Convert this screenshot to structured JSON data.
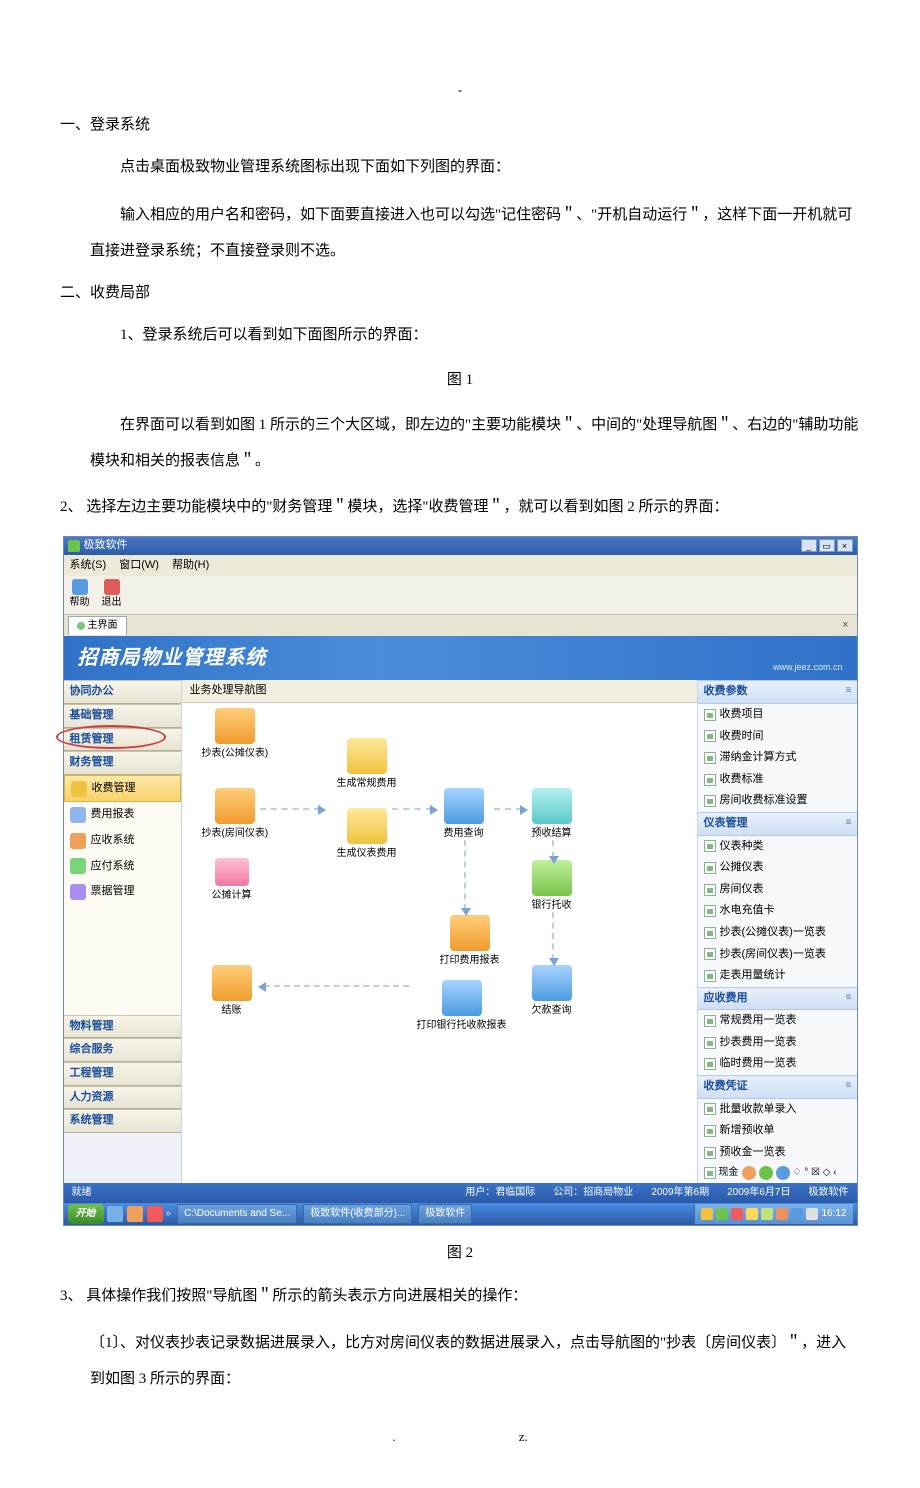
{
  "doc": {
    "dash": "-",
    "h1": "一、登录系统",
    "p1": "点击桌面极致物业管理系统图标出现下面如下列图的界面：",
    "p2": "输入相应的用户名和密码，如下面要直接进入也可以勾选\"记住密码＂、\"开机自动运行＂，这样下面一开机就可直接进登录系统；不直接登录则不选。",
    "h2": "二、收费局部",
    "p3": "1、登录系统后可以看到如下面图所示的界面：",
    "fig1": "图  1",
    "p4": "在界面可以看到如图 1 所示的三个大区域，即左边的\"主要功能模块＂、中间的\"处理导航图＂、右边的\"辅助功能模块和相关的报表信息＂。",
    "p5": "2、 选择左边主要功能模块中的\"财务管理＂模块，选择\"收费管理＂，就可以看到如图 2 所示的界面：",
    "fig2": "图 2",
    "p6": "3、 具体操作我们按照\"导航图＂所示的箭头表示方向进展相关的操作：",
    "p7": "〔1〕、对仪表抄表记录数据进展录入，比方对房间仪表的数据进展录入，点击导航图的\"抄表〔房间仪表〕＂，进入到如图 3 所示的界面：",
    "foot_left": ".",
    "foot_right": "z."
  },
  "app": {
    "title": "极致软件",
    "menu": {
      "sys": "系统(S)",
      "win": "窗口(W)",
      "help": "帮助(H)"
    },
    "toolbar": {
      "help": "帮助",
      "exit": "退出"
    },
    "tab": "主界面",
    "banner": "招商局物业管理系统",
    "banner_url": "www.jeez.com.cn",
    "canvas_title": "业务处理导航图",
    "sidebar": {
      "groups_top": [
        "协同办公",
        "基础管理",
        "租赁管理",
        "财务管理"
      ],
      "sub": {
        "pay": "收费管理",
        "report": "费用报表",
        "recv": "应收系统",
        "apply": "应付系统",
        "bill": "票据管理"
      },
      "groups_bottom": [
        "物料管理",
        "综合服务",
        "工程管理",
        "人力资源",
        "系统管理"
      ]
    },
    "nodes": {
      "meter_public": "抄表(公摊仪表)",
      "gen_regular": "生成常规费用",
      "meter_room": "抄表(房间仪表)",
      "gen_meter": "生成仪表费用",
      "apportion": "公摊计算",
      "fee_query": "费用查询",
      "pre_settle": "预收结算",
      "bank_collect": "银行托收",
      "print_fee": "打印费用报表",
      "settle": "结账",
      "print_bank": "打印银行托收款报表",
      "debt_query": "欠款查询"
    },
    "right": {
      "sect1": "收费参数",
      "s1": [
        "收费项目",
        "收费时间",
        "滞纳金计算方式",
        "收费标准",
        "房间收费标准设置"
      ],
      "sect2": "仪表管理",
      "s2": [
        "仪表种类",
        "公摊仪表",
        "房间仪表",
        "水电充值卡",
        "抄表(公摊仪表)一览表",
        "抄表(房间仪表)一览表",
        "走表用量统计"
      ],
      "sect3": "应收费用",
      "s3": [
        "常规费用一览表",
        "抄表费用一览表",
        "临时费用一览表"
      ],
      "sect4": "收费凭证",
      "s4": [
        "批量收款单录入",
        "新增预收单",
        "预收金一览表"
      ],
      "cash_label": "现金"
    },
    "status": {
      "left": "就绪",
      "user_label": "用户：",
      "user": "君临国际",
      "company_label": "公司：",
      "company": "招商局物业",
      "period": "2009年第6期",
      "date": "2009年6月7日",
      "vendor": "极致软件"
    },
    "taskbar": {
      "start": "开始",
      "t1": "C:\\Documents and Se...",
      "t2": "极致软件(收费部分)...",
      "t3": "极致软件",
      "time": "16:12"
    }
  }
}
